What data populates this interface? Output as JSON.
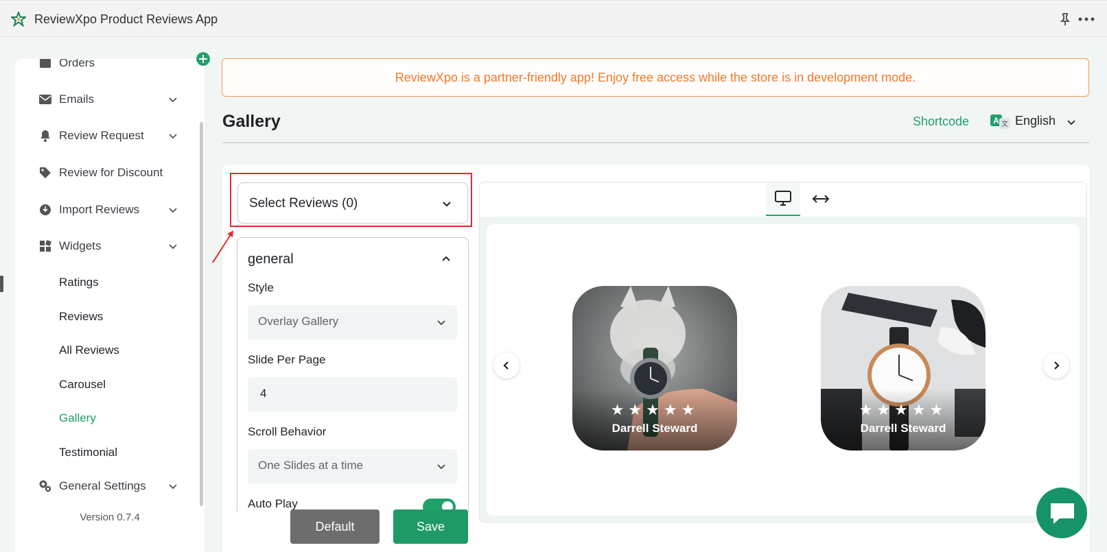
{
  "app": {
    "title": "ReviewXpo Product Reviews App"
  },
  "sidebar": {
    "partial_item": "Orders",
    "items": [
      {
        "label": "Emails",
        "icon": "mail-icon",
        "expandable": true
      },
      {
        "label": "Review Request",
        "icon": "bell-icon",
        "expandable": true
      },
      {
        "label": "Review for Discount",
        "icon": "tag-icon",
        "expandable": false
      },
      {
        "label": "Import Reviews",
        "icon": "import-icon",
        "expandable": true
      },
      {
        "label": "Widgets",
        "icon": "widgets-icon",
        "expandable": true
      }
    ],
    "widget_subitems": [
      "Ratings",
      "Reviews",
      "All Reviews",
      "Carousel",
      "Gallery",
      "Testimonial"
    ],
    "active_subitem": "Gallery",
    "settings_label": "General Settings",
    "version": "Version 0.7.4"
  },
  "banner": {
    "text": "ReviewXpo is a partner-friendly app! Enjoy free access while the store is in development mode."
  },
  "header": {
    "title": "Gallery",
    "shortcode_label": "Shortcode",
    "language": "English"
  },
  "select_reviews": {
    "label": "Select Reviews (0)"
  },
  "settings": {
    "section_title": "general",
    "style_label": "Style",
    "style_value": "Overlay Gallery",
    "slide_label": "Slide Per Page",
    "slide_value": "4",
    "scroll_label": "Scroll Behavior",
    "scroll_value": "One Slides at a time",
    "autoplay_label": "Auto Play",
    "autoplay_on": true
  },
  "buttons": {
    "default": "Default",
    "save": "Save"
  },
  "preview": {
    "cards": [
      {
        "name": "Darrell Steward",
        "stars": "★★★★★",
        "image": "husky-watch-photo"
      },
      {
        "name": "Darrell Steward",
        "stars": "★★★★★",
        "image": "watch-desk-photo"
      }
    ]
  },
  "colors": {
    "accent": "#22a06b",
    "banner": "#ec7b2c",
    "highlight": "#e32b2b"
  }
}
